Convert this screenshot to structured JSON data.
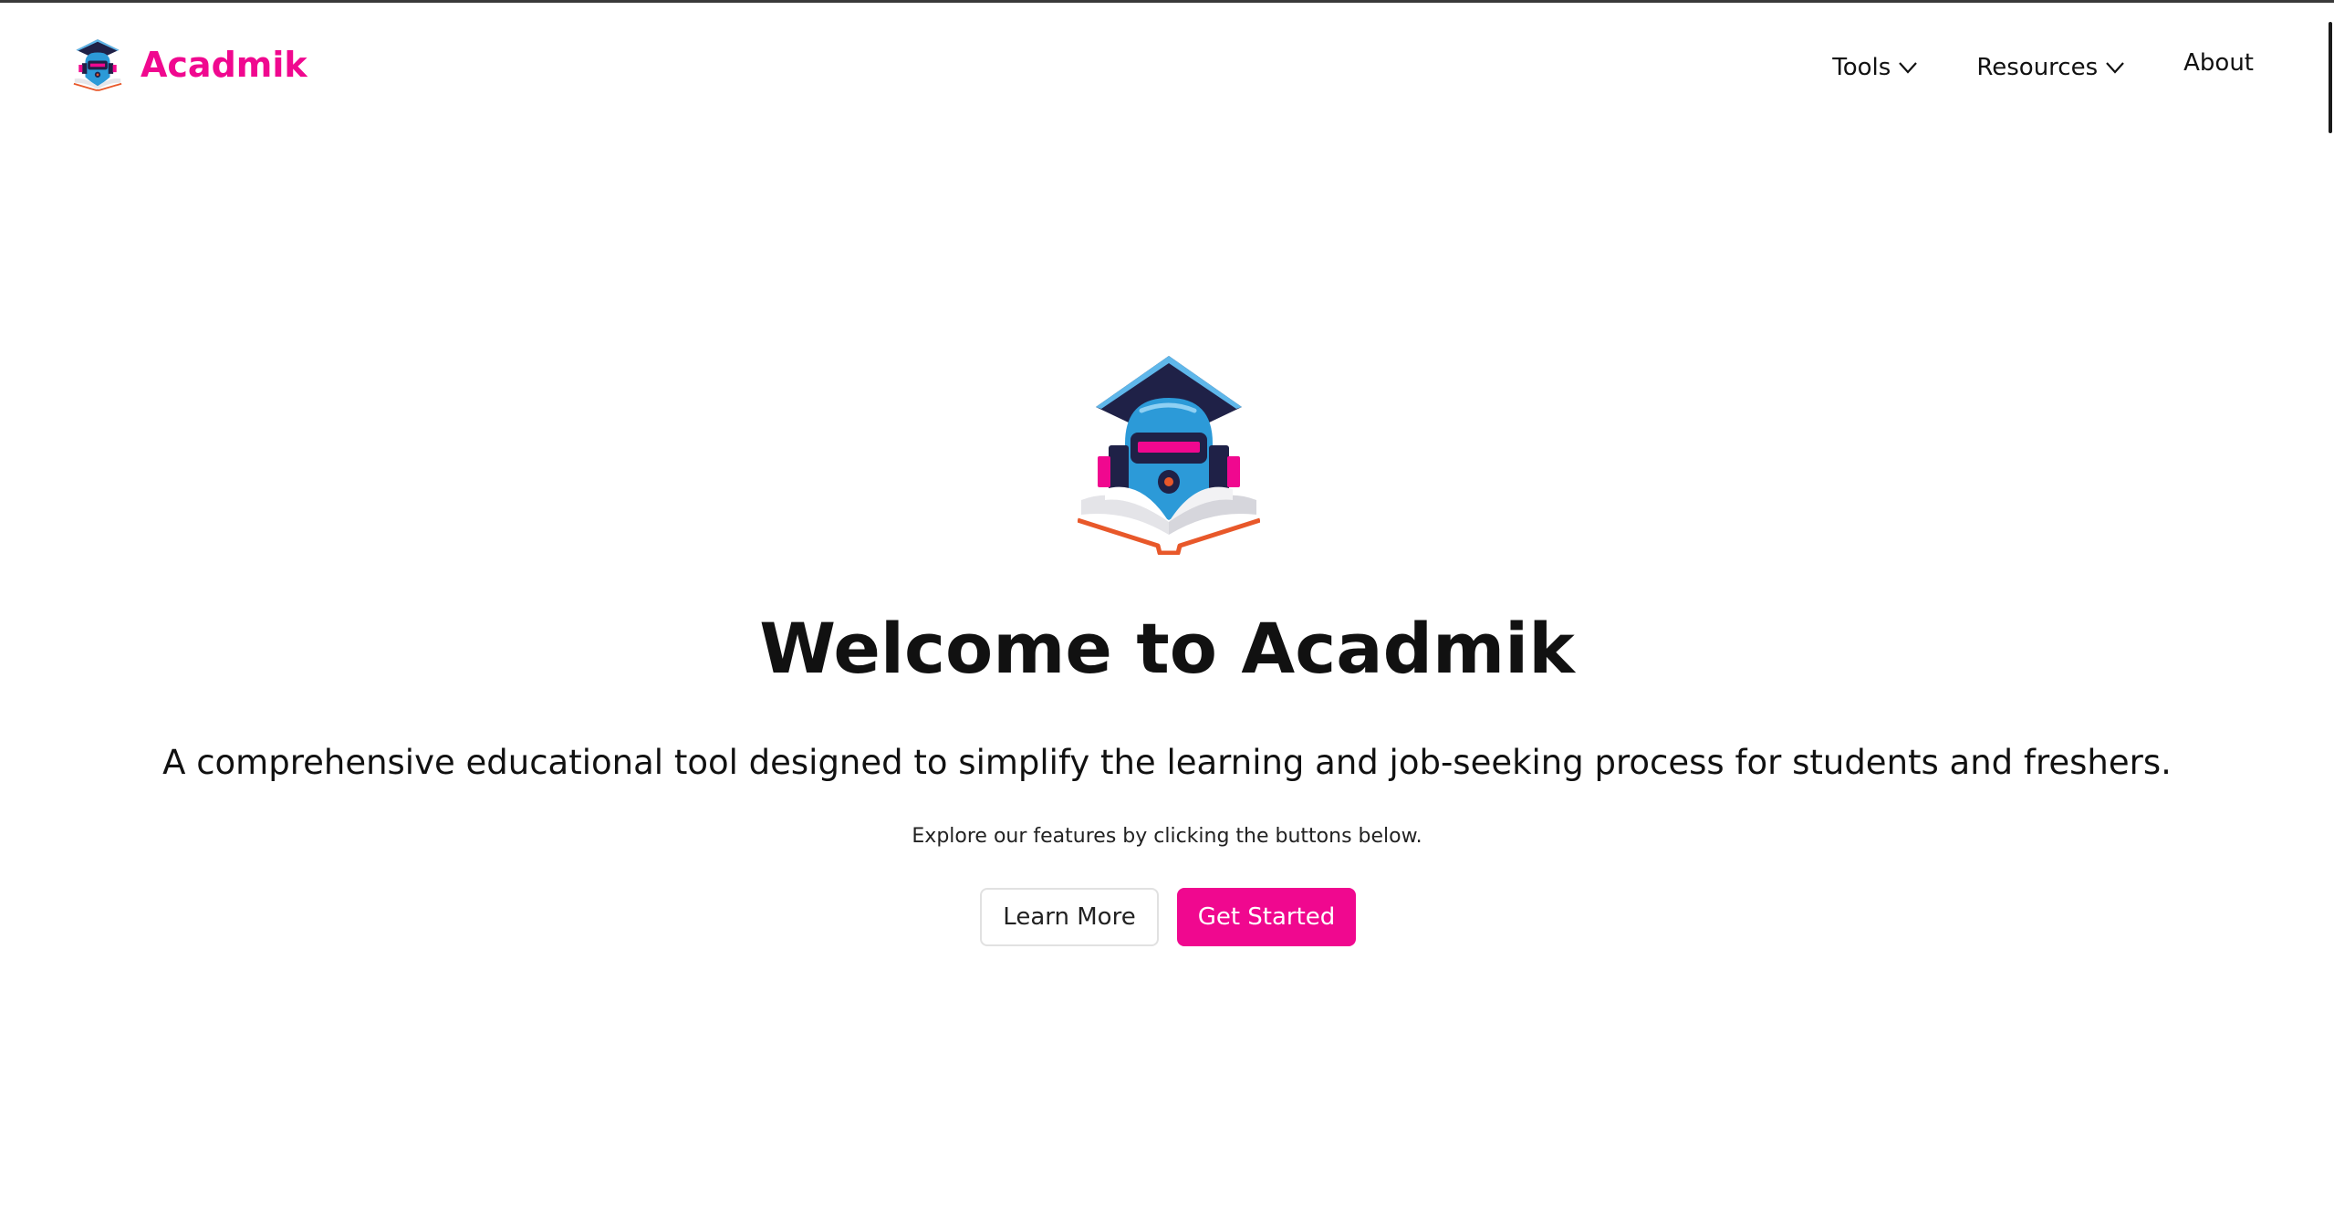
{
  "header": {
    "brand_name": "Acadmik",
    "nav": {
      "tools_label": "Tools",
      "resources_label": "Resources",
      "about_label": "About"
    }
  },
  "hero": {
    "title": "Welcome to Acadmik",
    "subtitle": "A comprehensive educational tool designed to simplify the learning and job-seeking process for students and freshers.",
    "note": "Explore our features by clicking the buttons below.",
    "learn_more_label": "Learn More",
    "get_started_label": "Get Started"
  },
  "icons": {
    "brand_logo": "graduation-robot-logo",
    "nav_chevron": "chevron-down-icon",
    "hero_logo": "graduation-robot-book-logo"
  },
  "colors": {
    "brand_pink": "#f0088f",
    "cap_navy": "#1f2147",
    "robot_blue": "#2c9ad8",
    "book_orange": "#e8582a",
    "text_dark": "#111111"
  }
}
